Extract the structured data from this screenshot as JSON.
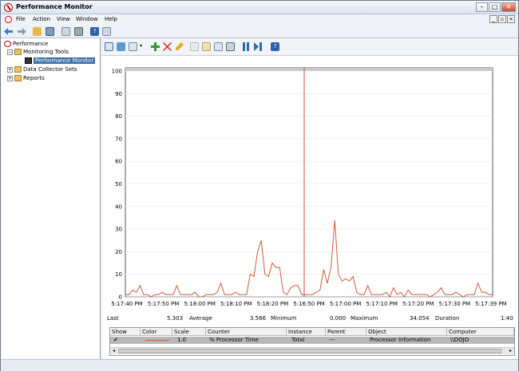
{
  "window": {
    "title": "Performance Monitor"
  },
  "menu": [
    "File",
    "Action",
    "View",
    "Window",
    "Help"
  ],
  "tree": {
    "root": "Performance",
    "monitoring_tools": "Monitoring Tools",
    "performance_monitor": "Performance Monitor",
    "data_collector_sets": "Data Collector Sets",
    "reports": "Reports"
  },
  "chart_data": {
    "type": "line",
    "ylim": [
      0,
      100
    ],
    "yticks": [
      "100",
      "90",
      "80",
      "70",
      "60",
      "50",
      "40",
      "30",
      "20",
      "10",
      "0"
    ],
    "xticks": [
      "5:17:40 PM",
      "5:17:50 PM",
      "5:18:00 PM",
      "5:18:10 PM",
      "5:18:20 PM",
      "5:16:50 PM",
      "5:17:00 PM",
      "5:17:10 PM",
      "5:17:20 PM",
      "5:17:30 PM",
      "5:17:39 PM"
    ],
    "color": "#d05a3a",
    "values": [
      1,
      1,
      3,
      2,
      5,
      1,
      1,
      0,
      1,
      1,
      2,
      1,
      1,
      1,
      5,
      1,
      1,
      1,
      1,
      2,
      0,
      0,
      1,
      1,
      1,
      2,
      6,
      1,
      1,
      1,
      2,
      1,
      1,
      1,
      10,
      9,
      20,
      25,
      10,
      9,
      15,
      13,
      13,
      2,
      1,
      4,
      5,
      5,
      1,
      1,
      1,
      1,
      2,
      3,
      12,
      6,
      13,
      34,
      10,
      7,
      8,
      7,
      9,
      2,
      1,
      1,
      5,
      1,
      1,
      1,
      1,
      2,
      0,
      4,
      1,
      2,
      0,
      3,
      1,
      1,
      1,
      1,
      1,
      0,
      1,
      2,
      4,
      1,
      1,
      1,
      2,
      1,
      0,
      1,
      1,
      1,
      6,
      2,
      2,
      1,
      1
    ]
  },
  "stats": {
    "last_label": "Last",
    "last": "5.303",
    "avg_label": "Average",
    "avg": "3.566",
    "min_label": "Minimum",
    "min": "0.000",
    "max_label": "Maximum",
    "max": "34.054",
    "dur_label": "Duration",
    "dur": "1:40"
  },
  "legend": {
    "headers": [
      "Show",
      "Color",
      "Scale",
      "Counter",
      "Instance",
      "Parent",
      "Object",
      "Computer"
    ],
    "row": {
      "show": "✔",
      "scale": "1.0",
      "counter": "% Processor Time",
      "instance": "Total",
      "parent": "---",
      "object": "Processor Information",
      "computer": "\\\\DOJO"
    }
  }
}
